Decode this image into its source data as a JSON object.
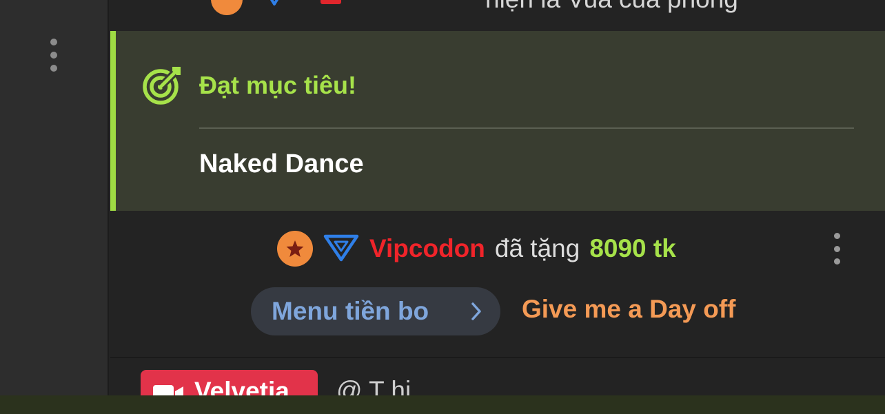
{
  "top_message": {
    "text": "hiện là Vua của phòng"
  },
  "goal": {
    "title": "Đạt mục tiêu!",
    "name": "Naked Dance",
    "accent_color": "#a6e24a",
    "icon": "target-icon"
  },
  "tip": {
    "username": "Vipcodon",
    "verb": "đã tặng",
    "amount": "8090 tk",
    "menu_label": "Menu tiền bo",
    "item": "Give me a Day off",
    "username_color": "#f0242a",
    "amount_color": "#a6e24a",
    "item_color": "#f49a55",
    "menu_color": "#7fa6dc",
    "icons": [
      "star-badge-icon",
      "triangle-rank-icon",
      "chevron-right-icon",
      "more-vertical-icon"
    ]
  },
  "bottom_message": {
    "username": "Velvetia",
    "mention": "@ T        hi",
    "badge_color": "#e2334a",
    "icon": "video-camera-icon"
  },
  "sidebar": {
    "icon": "more-vertical-icon"
  }
}
